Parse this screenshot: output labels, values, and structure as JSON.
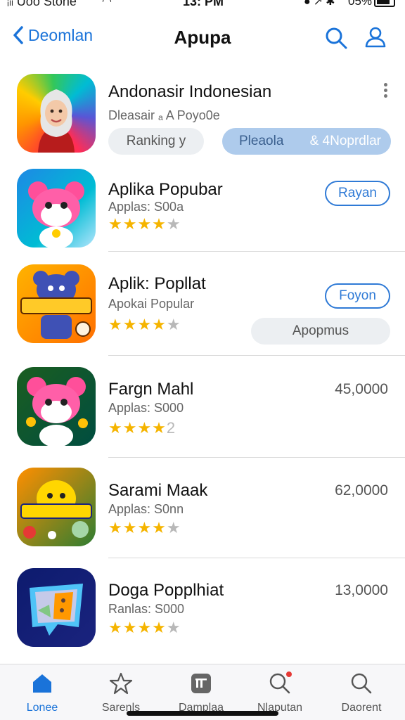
{
  "status_bar": {
    "carrier": "ᵢₗₗ Uoo Stone",
    "time": "13: PM",
    "battery": "05%"
  },
  "nav": {
    "back_label": "Deomlan",
    "title": "Apupa"
  },
  "featured": {
    "name": "Andonasir Indonesian",
    "subtitle": "Dleasair ₐ A Poyo0e",
    "chip_ranking": "Ranking  y",
    "chip_popular_left": "Pleaola",
    "chip_popular_right": "& 4Noprdlar"
  },
  "apps": [
    {
      "name": "Aplika Popubar",
      "subtitle": "Applas: S00a",
      "rating": 4,
      "action": "Rayan"
    },
    {
      "name": "Aplik: Popllat",
      "subtitle": "Apokai Popular",
      "rating": 4,
      "action": "Foyon",
      "secondary": "Apopmus"
    },
    {
      "name": "Fargn Mahl",
      "subtitle": "Applas: S000",
      "rating": 4,
      "price": "45,0000",
      "star_suffix": "2"
    },
    {
      "name": "Sarami Maak",
      "subtitle": "Applas: S0nn",
      "rating": 4,
      "price": "62,0000"
    },
    {
      "name": "Doga Popplhiat",
      "subtitle": "Ranlas: S000",
      "rating": 4,
      "price": "13,0000"
    }
  ],
  "tabs": [
    {
      "label": "Lonee",
      "icon": "home-icon",
      "active": true
    },
    {
      "label": "Sarenls",
      "icon": "star-icon"
    },
    {
      "label": "Damplaa",
      "icon": "apps-icon"
    },
    {
      "label": "Nlaputan",
      "icon": "search-notification-icon"
    },
    {
      "label": "Daorent",
      "icon": "search-icon"
    }
  ],
  "colors": {
    "accent": "#1a73d9",
    "star": "#f5b400",
    "chip_blue": "#aecbec"
  }
}
